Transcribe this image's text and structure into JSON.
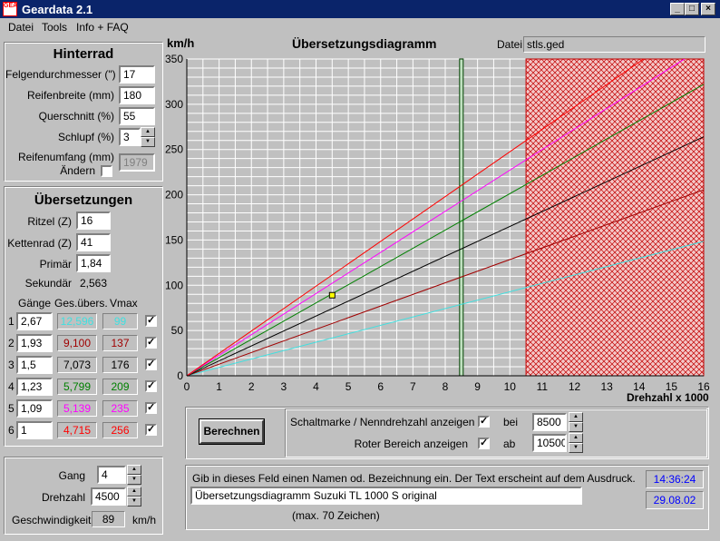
{
  "window": {
    "title": "Geardata 2.1",
    "icon_text": "GEA",
    "min": "_",
    "max": "□",
    "close": "×"
  },
  "menu": [
    "Datei",
    "Tools",
    "Info + FAQ"
  ],
  "hinterrad": {
    "title": "Hinterrad",
    "felgen_label": "Felgendurchmesser (\")",
    "felgen_value": "17",
    "breite_label": "Reifenbreite (mm)",
    "breite_value": "180",
    "quer_label": "Querschnitt (%)",
    "quer_value": "55",
    "schlupf_label": "Schlupf (%)",
    "schlupf_value": "3",
    "umfang_label": "Reifenumfang (mm)",
    "aendern_label": "Ändern",
    "umfang_value": "1979"
  },
  "uebersetzungen": {
    "title": "Übersetzungen",
    "ritzel_label": "Ritzel (Z)",
    "ritzel_value": "16",
    "ketten_label": "Kettenrad (Z)",
    "ketten_value": "41",
    "primaer_label": "Primär",
    "primaer_value": "1,84",
    "sekundaer_label": "Sekundär",
    "sekundaer_value": "2,563",
    "col_gaenge": "Gänge",
    "col_ges": "Ges.übers.",
    "col_vmax": "Vmax",
    "gears": [
      {
        "n": "1",
        "ratio": "2,67",
        "total": "12,596",
        "vmax": "99",
        "color": "#40e0e0",
        "checked": "✓"
      },
      {
        "n": "2",
        "ratio": "1,93",
        "total": "9,100",
        "vmax": "137",
        "color": "#a00000",
        "checked": "✓"
      },
      {
        "n": "3",
        "ratio": "1,5",
        "total": "7,073",
        "vmax": "176",
        "color": "#000000",
        "checked": "✓"
      },
      {
        "n": "4",
        "ratio": "1,23",
        "total": "5,799",
        "vmax": "209",
        "color": "#008000",
        "checked": "✓"
      },
      {
        "n": "5",
        "ratio": "1,09",
        "total": "5,139",
        "vmax": "235",
        "color": "#ff00ff",
        "checked": "✓"
      },
      {
        "n": "6",
        "ratio": "1",
        "total": "4,715",
        "vmax": "256",
        "color": "#ff0000",
        "checked": "✓"
      }
    ]
  },
  "calc": {
    "gang_label": "Gang",
    "gang_value": "4",
    "drehzahl_label": "Drehzahl",
    "drehzahl_value": "4500",
    "speed_label": "Geschwindigkeit:",
    "speed_value": "89",
    "speed_unit": "km/h"
  },
  "diagram": {
    "title": "Übersetzungsdiagramm",
    "ylabel": "km/h",
    "xlabel": "Drehzahl x 1000",
    "file_label": "Datei:",
    "file_value": "stls.ged"
  },
  "chart_data": {
    "type": "line",
    "xlabel": "Drehzahl x 1000",
    "ylabel": "km/h",
    "xlim": [
      0,
      16
    ],
    "ylim": [
      0,
      350
    ],
    "xticks": [
      "0",
      "1",
      "2",
      "3",
      "4",
      "5",
      "6",
      "7",
      "8",
      "9",
      "10",
      "11",
      "12",
      "13",
      "14",
      "15",
      "16"
    ],
    "yticks": [
      "0",
      "50",
      "100",
      "150",
      "200",
      "250",
      "300",
      "350"
    ],
    "grid": true,
    "shift_mark_rpm": 8.5,
    "red_zone_from": 10.5,
    "marker": {
      "x": 4.5,
      "y": 89
    },
    "series": [
      {
        "x": [
          0,
          16
        ],
        "y": [
          0,
          148.5
        ],
        "color": "#40e0e0"
      },
      {
        "x": [
          0,
          16
        ],
        "y": [
          0,
          205.5
        ],
        "color": "#a00000"
      },
      {
        "x": [
          0,
          16
        ],
        "y": [
          0,
          264.0
        ],
        "color": "#000000"
      },
      {
        "x": [
          0,
          16
        ],
        "y": [
          0,
          322.0
        ],
        "color": "#008000"
      },
      {
        "x": [
          0,
          16
        ],
        "y": [
          0,
          363.5
        ],
        "color": "#ff00ff"
      },
      {
        "x": [
          0,
          16
        ],
        "y": [
          0,
          396.0
        ],
        "color": "#ff0000"
      }
    ]
  },
  "controls": {
    "berechnen_label": "Berechnen",
    "schalt_label": "Schaltmarke / Nenndrehzahl anzeigen",
    "schalt_checked": "✓",
    "bei_label": "bei",
    "bei_value": "8500",
    "rot_label": "Roter Bereich anzeigen",
    "rot_checked": "✓",
    "ab_label": "ab",
    "ab_value": "10500"
  },
  "notes": {
    "hint": "Gib in dieses Feld einen Namen od. Bezeichnung ein. Der Text erscheint auf dem Ausdruck.",
    "value": "Übersetzungsdiagramm Suzuki TL 1000 S original",
    "max_text": "(max. 70 Zeichen)",
    "time": "14:36:24",
    "date": "29.08.02"
  }
}
